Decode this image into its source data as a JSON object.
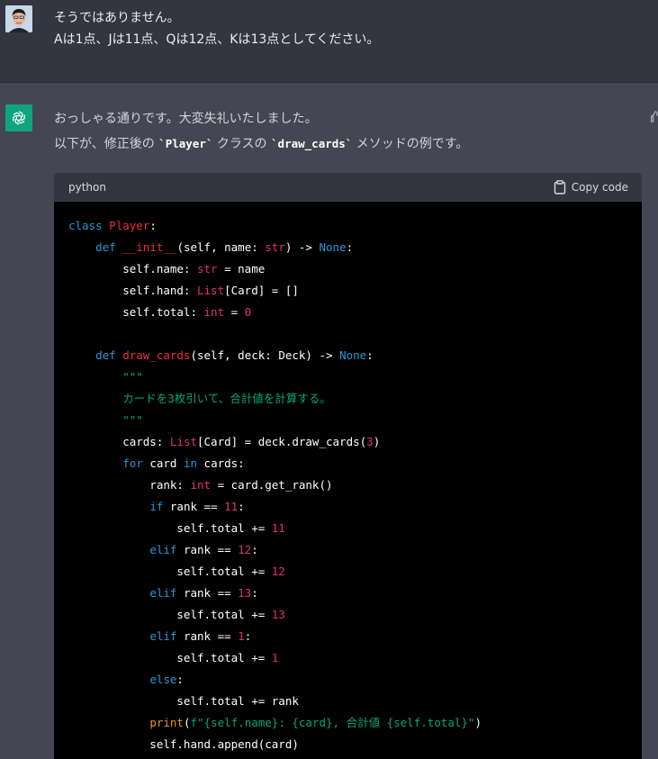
{
  "user_message": {
    "lines": [
      "そうではありません。",
      "Aは1点、Jは11点、Qは12点、Kは13点としてください。"
    ]
  },
  "assistant_message": {
    "line1": "おっしゃる通りです。大変失礼いたしました。",
    "line2_prefix": "以下が、修正後の ",
    "line2_code1": "`Player`",
    "line2_mid": " クラスの ",
    "line2_code2": "`draw_cards`",
    "line2_suffix": " メソッドの例です。"
  },
  "code_block": {
    "language": "python",
    "copy_label": "Copy code",
    "lines": [
      [
        [
          "kw",
          "class"
        ],
        [
          "t",
          " "
        ],
        [
          "cls",
          "Player"
        ],
        [
          "t",
          ":"
        ]
      ],
      [
        [
          "t",
          "    "
        ],
        [
          "kw",
          "def"
        ],
        [
          "t",
          " "
        ],
        [
          "fn",
          "__init__"
        ],
        [
          "t",
          "(self, name: "
        ],
        [
          "ty",
          "str"
        ],
        [
          "t",
          ") -> "
        ],
        [
          "kw",
          "None"
        ],
        [
          "t",
          ":"
        ]
      ],
      [
        [
          "t",
          "        self.name: "
        ],
        [
          "ty",
          "str"
        ],
        [
          "t",
          " = name"
        ]
      ],
      [
        [
          "t",
          "        self.hand: "
        ],
        [
          "ty",
          "List"
        ],
        [
          "t",
          "[Card] = []"
        ]
      ],
      [
        [
          "t",
          "        self.total: "
        ],
        [
          "ty",
          "int"
        ],
        [
          "t",
          " = "
        ],
        [
          "num",
          "0"
        ]
      ],
      [
        [
          "t",
          ""
        ]
      ],
      [
        [
          "t",
          "    "
        ],
        [
          "kw",
          "def"
        ],
        [
          "t",
          " "
        ],
        [
          "fn",
          "draw_cards"
        ],
        [
          "t",
          "(self, deck: Deck) -> "
        ],
        [
          "kw",
          "None"
        ],
        [
          "t",
          ":"
        ]
      ],
      [
        [
          "t",
          "        "
        ],
        [
          "str",
          "\"\"\""
        ]
      ],
      [
        [
          "str",
          "        カードを3枚引いて、合計値を計算する。"
        ]
      ],
      [
        [
          "t",
          "        "
        ],
        [
          "str",
          "\"\"\""
        ]
      ],
      [
        [
          "t",
          "        cards: "
        ],
        [
          "ty",
          "List"
        ],
        [
          "t",
          "[Card] = deck.draw_cards("
        ],
        [
          "num",
          "3"
        ],
        [
          "t",
          ")"
        ]
      ],
      [
        [
          "t",
          "        "
        ],
        [
          "kw",
          "for"
        ],
        [
          "t",
          " card "
        ],
        [
          "kw",
          "in"
        ],
        [
          "t",
          " cards:"
        ]
      ],
      [
        [
          "t",
          "            rank: "
        ],
        [
          "ty",
          "int"
        ],
        [
          "t",
          " = card.get_rank()"
        ]
      ],
      [
        [
          "t",
          "            "
        ],
        [
          "kw",
          "if"
        ],
        [
          "t",
          " rank == "
        ],
        [
          "num",
          "11"
        ],
        [
          "t",
          ":"
        ]
      ],
      [
        [
          "t",
          "                self.total += "
        ],
        [
          "num",
          "11"
        ]
      ],
      [
        [
          "t",
          "            "
        ],
        [
          "kw",
          "elif"
        ],
        [
          "t",
          " rank == "
        ],
        [
          "num",
          "12"
        ],
        [
          "t",
          ":"
        ]
      ],
      [
        [
          "t",
          "                self.total += "
        ],
        [
          "num",
          "12"
        ]
      ],
      [
        [
          "t",
          "            "
        ],
        [
          "kw",
          "elif"
        ],
        [
          "t",
          " rank == "
        ],
        [
          "num",
          "13"
        ],
        [
          "t",
          ":"
        ]
      ],
      [
        [
          "t",
          "                self.total += "
        ],
        [
          "num",
          "13"
        ]
      ],
      [
        [
          "t",
          "            "
        ],
        [
          "kw",
          "elif"
        ],
        [
          "t",
          " rank == "
        ],
        [
          "num",
          "1"
        ],
        [
          "t",
          ":"
        ]
      ],
      [
        [
          "t",
          "                self.total += "
        ],
        [
          "num",
          "1"
        ]
      ],
      [
        [
          "t",
          "            "
        ],
        [
          "kw",
          "else"
        ],
        [
          "t",
          ":"
        ]
      ],
      [
        [
          "t",
          "                self.total += rank"
        ]
      ],
      [
        [
          "t",
          "            "
        ],
        [
          "bi",
          "print"
        ],
        [
          "t",
          "("
        ],
        [
          "str",
          "f\"{self.name}: {card}, 合計値 {self.total}\""
        ],
        [
          "t",
          ")"
        ]
      ],
      [
        [
          "t",
          "            self.hand.append(card)"
        ]
      ]
    ]
  },
  "colors": {
    "page_bg": "#444654",
    "user_bg": "#343541",
    "code_bg": "#000000",
    "gpt_logo": "#10a37f"
  }
}
